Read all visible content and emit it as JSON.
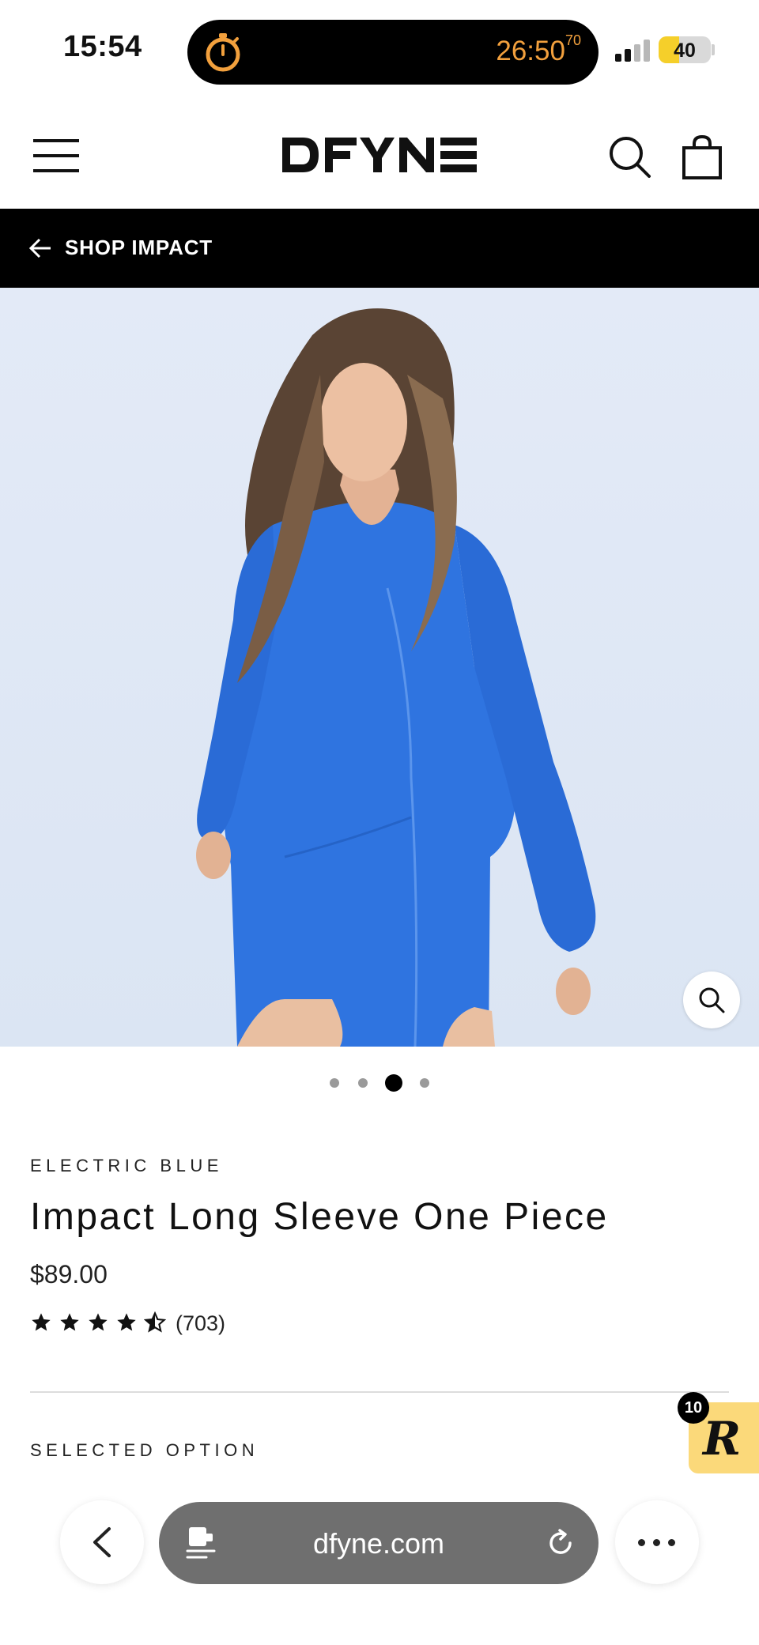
{
  "status_bar": {
    "time": "15:54",
    "timer": "26:50",
    "timer_fraction": "70",
    "battery_level": "40",
    "battery_percent": 40,
    "icons": [
      "stopwatch-icon",
      "cellular-signal-icon",
      "battery-icon"
    ]
  },
  "header": {
    "logo_text": "DFYNE",
    "icons": [
      "hamburger-menu-icon",
      "search-icon",
      "shopping-bag-icon"
    ]
  },
  "collection_bar": {
    "label": "SHOP IMPACT",
    "icon": "arrow-left-icon"
  },
  "gallery": {
    "image_count": 4,
    "active_index": 2,
    "zoom_icon": "zoom-icon"
  },
  "product": {
    "color": "ELECTRIC BLUE",
    "title": "Impact Long Sleeve One Piece",
    "price": "$89.00",
    "rating": 4.5,
    "review_count": "(703)",
    "selected_option_label": "SELECTED OPTION"
  },
  "rewards": {
    "badge_count": "10",
    "letter": "R"
  },
  "browser": {
    "url": "dfyne.com",
    "icons": [
      "back-chevron-icon",
      "page-info-icon",
      "reload-icon",
      "more-dots-icon"
    ]
  },
  "colors": {
    "accent_timer": "#f2a03d",
    "battery": "#f5cf2a",
    "rewards_bg": "#fbd97a",
    "product_blue": "#2f74e0"
  }
}
